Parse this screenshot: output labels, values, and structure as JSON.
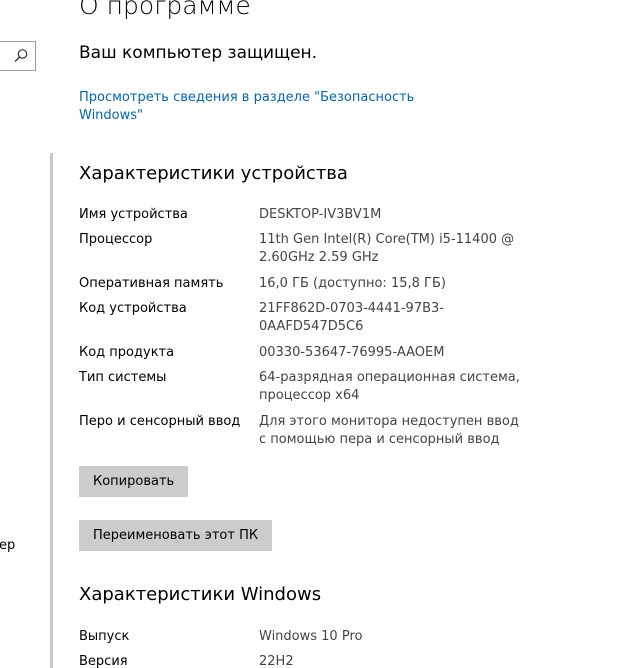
{
  "sidebar": {
    "search_icon": "search-icon",
    "cut_item_label": "ер"
  },
  "header": {
    "title": "О программе"
  },
  "security": {
    "status": "Ваш компьютер защищен.",
    "link_line1": "Просмотреть сведения в разделе \"Безопасность",
    "link_line2": "Windows\""
  },
  "device": {
    "heading": "Характеристики устройства",
    "specs": [
      {
        "label": "Имя устройства",
        "value": "DESKTOP-IV3BV1M"
      },
      {
        "label": "Процессор",
        "value": "11th Gen Intel(R) Core(TM) i5-11400 @ 2.60GHz   2.59 GHz"
      },
      {
        "label": "Оперативная память",
        "value": "16,0 ГБ (доступно: 15,8 ГБ)"
      },
      {
        "label": "Код устройства",
        "value": "21FF862D-0703-4441-97B3-0AAFD547D5C6"
      },
      {
        "label": "Код продукта",
        "value": "00330-53647-76995-AAOEM"
      },
      {
        "label": "Тип системы",
        "value": "64-разрядная операционная система, процессор x64"
      },
      {
        "label": "Перо и сенсорный ввод",
        "value": "Для этого монитора недоступен ввод с помощью пера и сенсорный ввод"
      }
    ],
    "copy_button": "Копировать",
    "rename_button": "Переименовать этот ПК"
  },
  "windows": {
    "heading": "Характеристики Windows",
    "specs": [
      {
        "label": "Выпуск",
        "value": "Windows 10 Pro"
      },
      {
        "label": "Версия",
        "value": "22H2"
      }
    ]
  },
  "colors": {
    "link": "#0067b8",
    "button_bg": "#cccccc",
    "value_text": "#444444"
  }
}
